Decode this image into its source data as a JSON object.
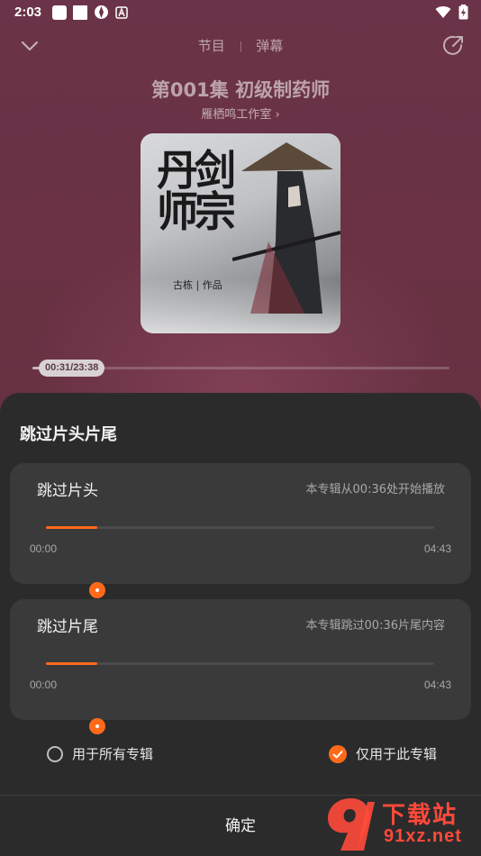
{
  "status_bar": {
    "time": "2:03"
  },
  "header": {
    "tabs": [
      "节目",
      "弹幕"
    ]
  },
  "episode": {
    "title": "第001集 初级制药师",
    "studio": "雁栖鸣工作室"
  },
  "cover": {
    "calligraphy_line1": "丹剑",
    "calligraphy_line2": "师宗",
    "author": "古栋 | 作品"
  },
  "playback": {
    "time_display": "00:31/23:38",
    "progress": 0.022
  },
  "sheet": {
    "title": "跳过片头片尾",
    "intro": {
      "label": "跳过片头",
      "note": "本专辑从00:36处开始播放",
      "min": "00:00",
      "max": "04:43",
      "fraction": 0.133
    },
    "outro": {
      "label": "跳过片尾",
      "note": "本专辑跳过00:36片尾内容",
      "min": "00:00",
      "max": "04:43",
      "fraction": 0.133
    },
    "options": {
      "all_albums": "用于所有专辑",
      "this_album": "仅用于此专辑",
      "selected": "this_album"
    },
    "confirm_label": "确定"
  },
  "watermark": {
    "cn": "下载站",
    "en": "91xz.net"
  },
  "colors": {
    "accent": "#ff6a1a",
    "sheet_bg": "#2b2b2c",
    "card_bg": "#3a3a3b"
  }
}
